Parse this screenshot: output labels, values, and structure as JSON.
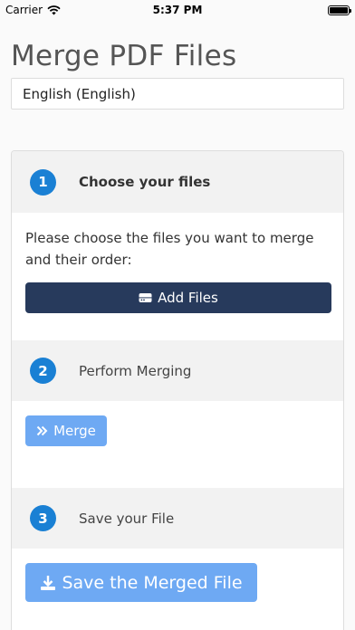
{
  "status_bar": {
    "carrier": "Carrier",
    "time": "5:37 PM",
    "wifi_icon": "wifi-icon",
    "battery_icon": "battery-icon"
  },
  "page": {
    "title": "Merge PDF Files"
  },
  "language": {
    "selected": "English (English)"
  },
  "steps": [
    {
      "number": "1",
      "title": "Choose your files",
      "description": "Please choose the files you want to merge and their order:",
      "button_label": "Add Files",
      "button_icon": "drive-icon"
    },
    {
      "number": "2",
      "title": "Perform Merging",
      "button_label": "Merge",
      "button_icon": "double-chevron-right-icon"
    },
    {
      "number": "3",
      "title": "Save your File",
      "button_label": "Save the Merged File",
      "button_icon": "download-icon"
    }
  ],
  "colors": {
    "step_badge": "#1a80d4",
    "add_button": "#273a5c",
    "action_button": "#6ea9f3",
    "header_bg": "#f2f2f2"
  }
}
